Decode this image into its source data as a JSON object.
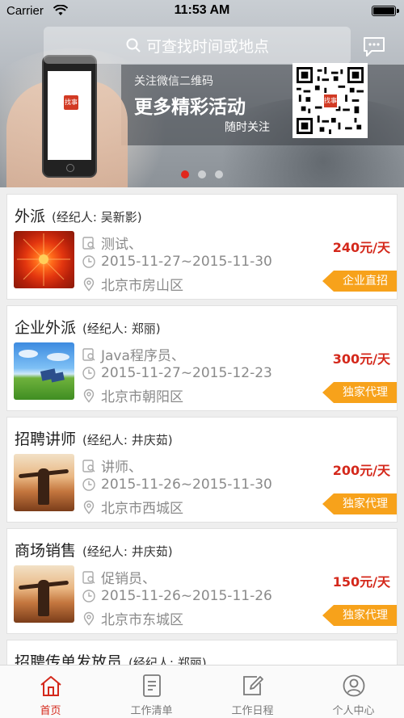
{
  "status_bar": {
    "carrier": "Carrier",
    "time": "11:53 AM"
  },
  "search": {
    "placeholder": "可查找时间或地点"
  },
  "banner": {
    "line1": "关注微信二维码",
    "line2": "更多精彩活动",
    "line3": "随时关注",
    "qr_logo": "找事",
    "phone_logo": "找事",
    "carousel_pages": 3,
    "carousel_active": 1
  },
  "jobs": [
    {
      "title": "外派",
      "agent": "(经纪人: 吴新影)",
      "position": "测试、",
      "dates": "2015-11-27~2015-11-30",
      "location": "北京市房山区",
      "price": "240元/天",
      "tag": "企业直招",
      "thumb": "flower"
    },
    {
      "title": "企业外派",
      "agent": "(经纪人: 郑丽)",
      "position": "Java程序员、",
      "dates": "2015-11-27~2015-12-23",
      "location": "北京市朝阳区",
      "price": "300元/天",
      "tag": "独家代理",
      "thumb": "field"
    },
    {
      "title": "招聘讲师",
      "agent": "(经纪人: 井庆茹)",
      "position": "讲师、",
      "dates": "2015-11-26~2015-11-30",
      "location": "北京市西城区",
      "price": "200元/天",
      "tag": "独家代理",
      "thumb": "sunset"
    },
    {
      "title": "商场销售",
      "agent": "(经纪人: 井庆茹)",
      "position": "促销员、",
      "dates": "2015-11-26~2015-11-26",
      "location": "北京市东城区",
      "price": "150元/天",
      "tag": "独家代理",
      "thumb": "sunset"
    },
    {
      "title": "招聘传单发放员",
      "agent": "(经纪人: 郑丽)"
    }
  ],
  "tabs": [
    {
      "label": "首页",
      "icon": "home-icon",
      "active": true
    },
    {
      "label": "工作清单",
      "icon": "list-icon",
      "active": false
    },
    {
      "label": "工作日程",
      "icon": "edit-icon",
      "active": false
    },
    {
      "label": "个人中心",
      "icon": "user-icon",
      "active": false
    }
  ],
  "colors": {
    "accent": "#d4281b",
    "tag": "#f7a21b",
    "muted": "#8a8a8a",
    "carousel_active": "#e0271c"
  }
}
